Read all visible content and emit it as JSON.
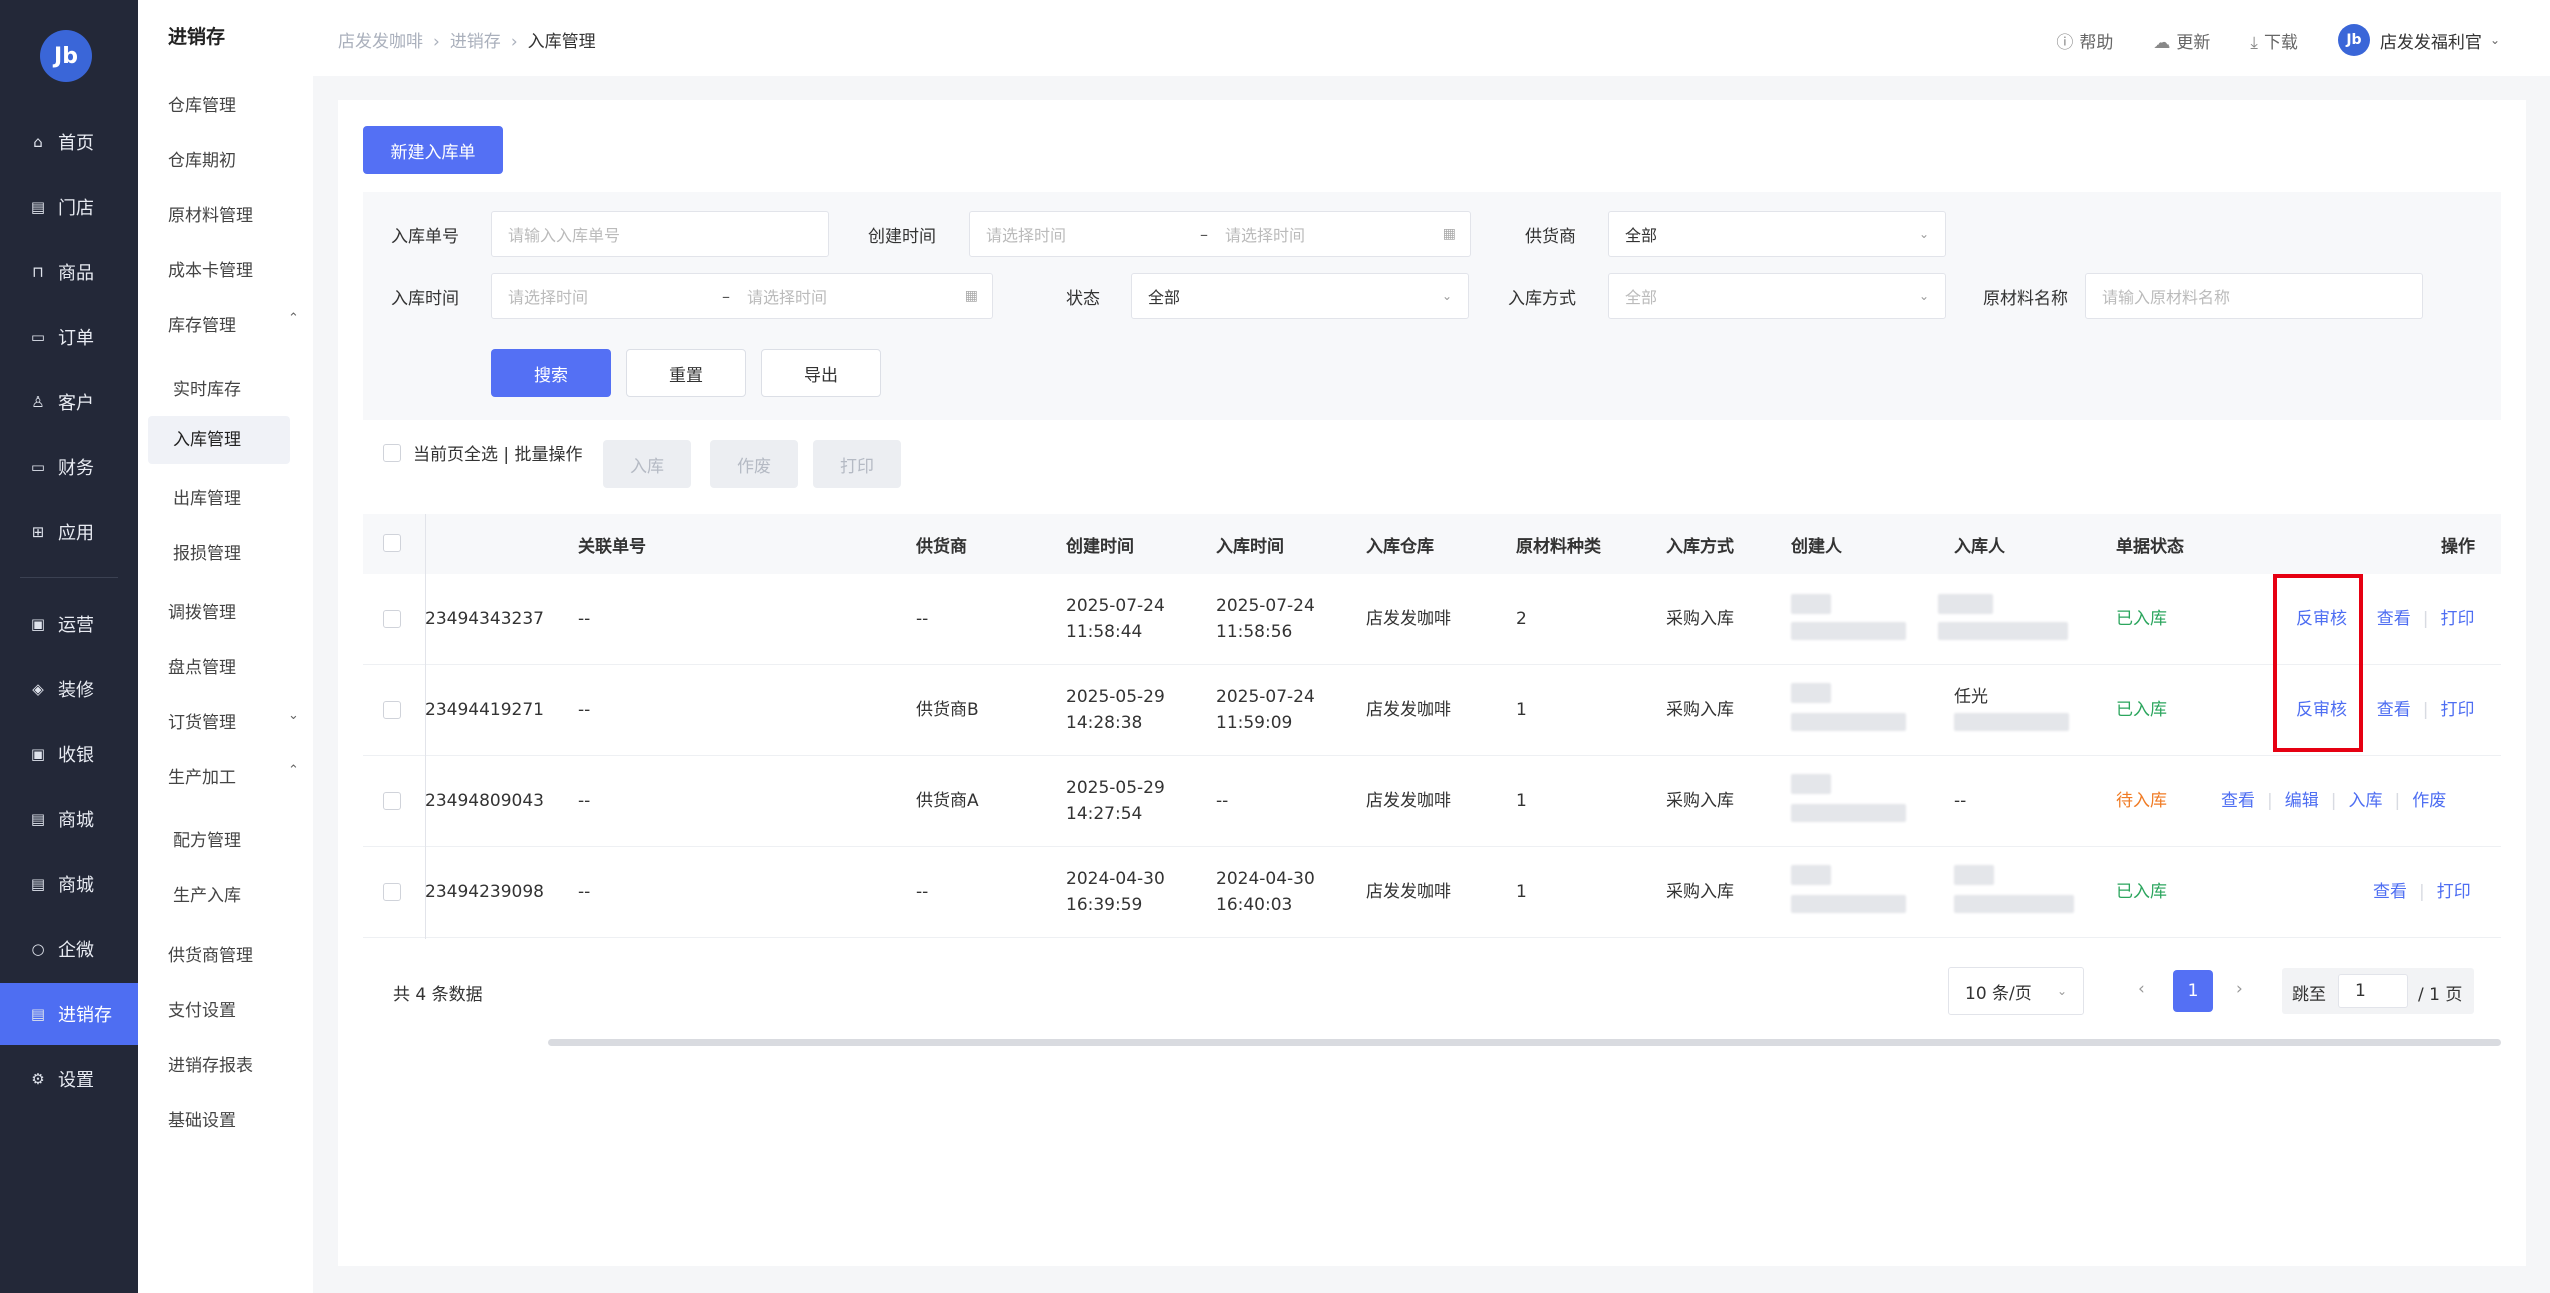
{
  "nav": {
    "logo": "Jb",
    "items": [
      {
        "label": "首页",
        "icon": "home-icon",
        "glyph": "⌂"
      },
      {
        "label": "门店",
        "icon": "store-icon",
        "glyph": "▤"
      },
      {
        "label": "商品",
        "icon": "bag-icon",
        "glyph": "⊓"
      },
      {
        "label": "订单",
        "icon": "order-icon",
        "glyph": "▭"
      },
      {
        "label": "客户",
        "icon": "user-icon",
        "glyph": "♙"
      },
      {
        "label": "财务",
        "icon": "wallet-icon",
        "glyph": "▭"
      },
      {
        "label": "应用",
        "icon": "apps-icon",
        "glyph": "⊞"
      },
      {
        "label": "运营",
        "icon": "gift-icon",
        "glyph": "▣"
      },
      {
        "label": "装修",
        "icon": "layers-icon",
        "glyph": "◈"
      },
      {
        "label": "收银",
        "icon": "cashier-icon",
        "glyph": "▣"
      },
      {
        "label": "商城",
        "icon": "mall-icon",
        "glyph": "▤"
      },
      {
        "label": "商城",
        "icon": "mall-icon",
        "glyph": "▤"
      },
      {
        "label": "企微",
        "icon": "chat-icon",
        "glyph": "○"
      },
      {
        "label": "进销存",
        "icon": "inventory-icon",
        "glyph": "▤"
      },
      {
        "label": "设置",
        "icon": "settings-icon",
        "glyph": "⚙"
      }
    ]
  },
  "submenu": {
    "title": "进销存",
    "items": [
      {
        "label": "仓库管理"
      },
      {
        "label": "仓库期初"
      },
      {
        "label": "原材料管理"
      },
      {
        "label": "成本卡管理"
      },
      {
        "label": "库存管理",
        "chev": "⌃"
      },
      {
        "label": "实时库存"
      },
      {
        "label": "入库管理"
      },
      {
        "label": "出库管理"
      },
      {
        "label": "报损管理"
      },
      {
        "label": "调拨管理"
      },
      {
        "label": "盘点管理"
      },
      {
        "label": "订货管理",
        "chev": "⌄"
      },
      {
        "label": "生产加工",
        "chev": "⌃"
      },
      {
        "label": "配方管理"
      },
      {
        "label": "生产入库"
      },
      {
        "label": "供货商管理"
      },
      {
        "label": "支付设置"
      },
      {
        "label": "进销存报表"
      },
      {
        "label": "基础设置"
      }
    ]
  },
  "breadcrumb": [
    "店发发咖啡",
    "进销存",
    "入库管理"
  ],
  "topbar": {
    "help": "帮助",
    "update": "更新",
    "download": "下载",
    "user": "店发发福利官",
    "avatar": "Jb"
  },
  "new_button": "新建入库单",
  "filters": {
    "order_no": {
      "label": "入库单号",
      "placeholder": "请输入入库单号"
    },
    "create_time": {
      "label": "创建时间",
      "start": "请选择时间",
      "end": "请选择时间"
    },
    "supplier": {
      "label": "供货商",
      "value": "全部"
    },
    "in_time": {
      "label": "入库时间",
      "start": "请选择时间",
      "end": "请选择时间"
    },
    "status": {
      "label": "状态",
      "value": "全部"
    },
    "method": {
      "label": "入库方式",
      "value": "全部"
    },
    "material": {
      "label": "原材料名称",
      "placeholder": "请输入原材料名称"
    },
    "dash": "–",
    "search": "搜索",
    "reset": "重置",
    "export": "导出"
  },
  "bulk": {
    "label": "当前页全选 | 批量操作",
    "inbound": "入库",
    "void": "作废",
    "print": "打印"
  },
  "table": {
    "headers": [
      "关联单号",
      "供货商",
      "创建时间",
      "入库时间",
      "入库仓库",
      "原材料种类",
      "入库方式",
      "创建人",
      "入库人",
      "单据状态",
      "操作"
    ],
    "rows": [
      {
        "id": "23494343237",
        "ref": "--",
        "supplier": "--",
        "created": "2025-07-24",
        "created_t": "11:58:44",
        "in": "2025-07-24",
        "in_t": "11:58:56",
        "warehouse": "店发发咖啡",
        "kinds": "2",
        "method": "采购入库",
        "receiver": "",
        "status": "已入库",
        "status_type": "ok"
      },
      {
        "id": "23494419271",
        "ref": "--",
        "supplier": "供货商B",
        "created": "2025-05-29",
        "created_t": "14:28:38",
        "in": "2025-07-24",
        "in_t": "11:59:09",
        "warehouse": "店发发咖啡",
        "kinds": "1",
        "method": "采购入库",
        "receiver": "任光",
        "status": "已入库",
        "status_type": "ok"
      },
      {
        "id": "23494809043",
        "ref": "--",
        "supplier": "供货商A",
        "created": "2025-05-29",
        "created_t": "14:27:54",
        "in": "--",
        "in_t": "",
        "warehouse": "店发发咖啡",
        "kinds": "1",
        "method": "采购入库",
        "receiver": "--",
        "status": "待入库",
        "status_type": "wait"
      },
      {
        "id": "23494239098",
        "ref": "--",
        "supplier": "--",
        "created": "2024-04-30",
        "created_t": "16:39:59",
        "in": "2024-04-30",
        "in_t": "16:40:03",
        "warehouse": "店发发咖啡",
        "kinds": "1",
        "method": "采购入库",
        "receiver": "",
        "status": "已入库",
        "status_type": "ok"
      }
    ],
    "actions": {
      "unreview": "反审核",
      "view": "查看",
      "print": "打印",
      "edit": "编辑",
      "inbound": "入库",
      "void": "作废"
    }
  },
  "pagination": {
    "total": "共 4 条数据",
    "page_size": "10 条/页",
    "current": "1",
    "goto": "跳至",
    "goto_value": "1",
    "pages": "/ 1 页"
  },
  "colors": {
    "primary": "#5470f4",
    "nav_bg": "#232838",
    "success": "#2ba55d",
    "warning": "#f07b24",
    "highlight": "#e60012"
  }
}
